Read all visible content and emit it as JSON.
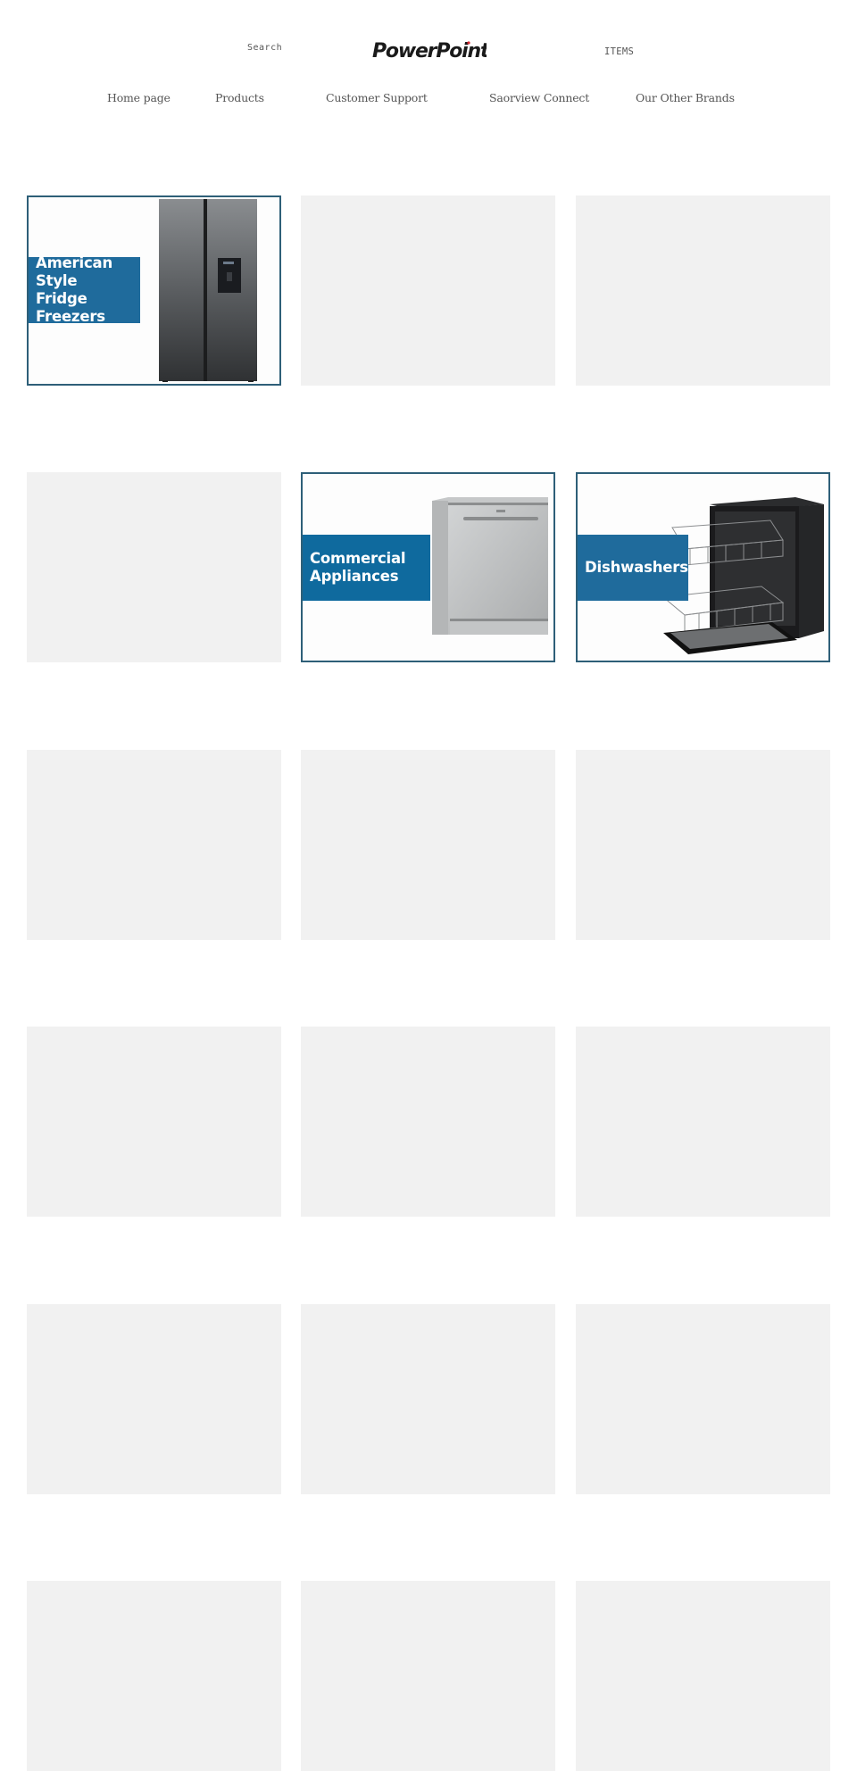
{
  "header": {
    "search_label": "Search",
    "logo_text": "PowerPoint",
    "logo_accent_color": "#d6262e",
    "cart_label": "ITEMS"
  },
  "nav": {
    "items": [
      {
        "label": "Home page"
      },
      {
        "label": "Products"
      },
      {
        "label": "Customer Support"
      },
      {
        "label": "Saorview Connect"
      },
      {
        "label": "Our Other Brands"
      }
    ]
  },
  "grid": {
    "accent_color": "#1f6b9c",
    "border_color": "#2e5f78",
    "placeholder_color": "#f1f1f1",
    "cards": [
      {
        "title": "American\nStyle Fridge\nFreezers",
        "image": "american-fridge-freezer",
        "loaded": true
      },
      {
        "title": "",
        "loaded": false
      },
      {
        "title": "",
        "loaded": false
      },
      {
        "title": "",
        "loaded": false
      },
      {
        "title": "Commercial\nAppliances",
        "image": "silver-dishwasher",
        "loaded": true
      },
      {
        "title": "Dishwashers",
        "image": "black-dishwasher-open",
        "loaded": true
      },
      {
        "title": "",
        "loaded": false
      },
      {
        "title": "",
        "loaded": false
      },
      {
        "title": "",
        "loaded": false
      },
      {
        "title": "",
        "loaded": false
      },
      {
        "title": "",
        "loaded": false
      },
      {
        "title": "",
        "loaded": false
      },
      {
        "title": "",
        "loaded": false
      },
      {
        "title": "",
        "loaded": false
      },
      {
        "title": "",
        "loaded": false
      },
      {
        "title": "",
        "loaded": false
      },
      {
        "title": "",
        "loaded": false
      },
      {
        "title": "",
        "loaded": false
      }
    ]
  }
}
